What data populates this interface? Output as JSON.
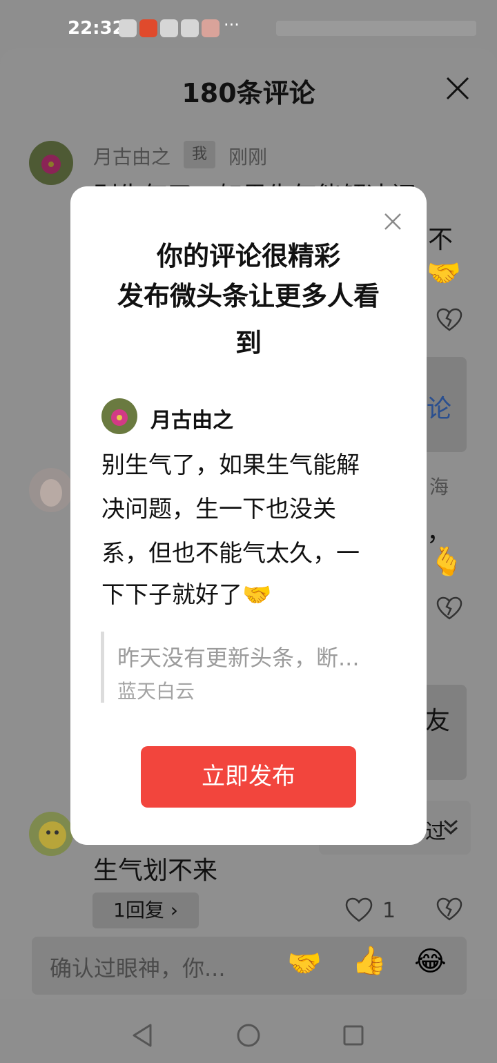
{
  "status_bar": {
    "time": "22:32",
    "notification_icons": [
      "baidu-paw-icon",
      "taobao-icon",
      "baidu-paw-icon",
      "baidu-paw-icon",
      "app-red-icon"
    ],
    "more": "···"
  },
  "comment_sheet": {
    "title": "180条评论",
    "comments": [
      {
        "author": "月古由之",
        "me_tag": "我",
        "time": "刚刚",
        "text_lines": [
          "别生气了，如果生气能解决问",
          "不"
        ]
      },
      {
        "author_partial": "海",
        "text_partial": [
          "论",
          "，"
        ]
      },
      {
        "text_partial": "友"
      },
      {
        "text": "生气划不来",
        "reply_button": "1回复 ›",
        "like_count": "1",
        "fold_partial": "过"
      }
    ]
  },
  "bottom_input": {
    "placeholder": "确认过眼神，你...",
    "quick_emojis": [
      "🤝",
      "👍",
      "😂"
    ]
  },
  "dialog": {
    "title_lines": [
      "你的评论很精彩",
      "发布微头条让更多人看",
      "到"
    ],
    "author": "月古由之",
    "body_lines": [
      "别生气了，如果生气能解",
      "决问题，生一下也没关",
      "系，但也不能气太久，一",
      "下下子就好了🤝"
    ],
    "quote_text": "昨天没有更新头条，断...",
    "quote_author": "蓝天白云",
    "publish_button": "立即发布"
  },
  "colors": {
    "accent_red": "#f2453d",
    "overlay_gray": "#8e8e8e",
    "dialog_bg": "#ffffff"
  }
}
